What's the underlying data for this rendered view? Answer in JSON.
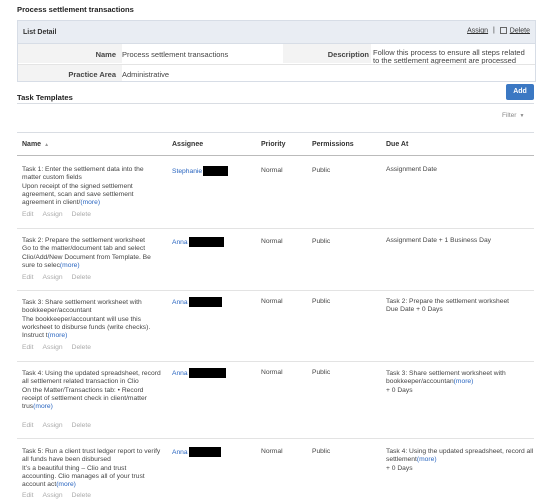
{
  "page_title": "Process settlement transactions",
  "list_detail": {
    "label": "List Detail",
    "assign": "Assign",
    "separator": "|",
    "delete": "Delete",
    "name_label": "Name",
    "name_value": "Process settlement transactions",
    "description_label": "Description",
    "description_value": "Follow this process to ensure all steps related to the settlement agreement are processed",
    "practice_label": "Practice Area",
    "practice_value": "Administrative"
  },
  "task_templates": {
    "title": "Task Templates",
    "add_label": "Add",
    "filter_label": "Filter",
    "columns": {
      "name": "Name",
      "assignee": "Assignee",
      "priority": "Priority",
      "permissions": "Permissions",
      "due_at": "Due At"
    },
    "actions": {
      "edit": "Edit",
      "assign": "Assign",
      "delete": "Delete"
    },
    "rows": [
      {
        "title": "Task 1: Enter the settlement data into the matter custom fields",
        "body": "Upon receipt of the signed settlement agreement, scan and save settlement agreement in client/",
        "more": "(more)",
        "assignee": "Stephanie",
        "priority": "Normal",
        "permissions": "Public",
        "due_main": "Assignment Date",
        "due_more": "",
        "due_sub": ""
      },
      {
        "title": "Task 2: Prepare the settlement worksheet",
        "body": "Go to the matter/document tab and select Clio/Add/New Document from Template. Be sure to selec",
        "more": "(more)",
        "assignee": "Anna",
        "priority": "Normal",
        "permissions": "Public",
        "due_main": "Assignment Date + 1 Business Day",
        "due_more": "",
        "due_sub": ""
      },
      {
        "title": "Task 3: Share settlement worksheet with bookkeeper/accountant",
        "body": "The bookkeeper/accountant will use this worksheet to disburse funds (write checks). Instruct t",
        "more": "(more)",
        "assignee": "Anna",
        "priority": "Normal",
        "permissions": "Public",
        "due_main": "Task 2: Prepare the settlement worksheet",
        "due_more": "",
        "due_sub": "Due Date + 0 Days"
      },
      {
        "title": "Task 4: Using the updated spreadsheet, record all settlement related transaction in Clio",
        "body": "On the Matter/Transactions tab: • Record receipt of settlement check in client/matter trus",
        "more": "(more)",
        "assignee": "Anna",
        "priority": "Normal",
        "permissions": "Public",
        "due_main": "Task 3: Share settlement worksheet with bookkeeper/accountan",
        "due_more": "(more)",
        "due_sub": "+ 0 Days"
      },
      {
        "title": "Task 5: Run a client trust ledger report to verify all funds have been disbursed",
        "body": "It’s a beautiful thing – Clio and trust accounting. Clio manages all of your trust account act",
        "more": "(more)",
        "assignee": "Anna",
        "priority": "Normal",
        "permissions": "Public",
        "due_main": "Task 4: Using the updated spreadsheet, record all settlement",
        "due_more": "(more)",
        "due_sub": "+ 0 Days"
      }
    ]
  }
}
